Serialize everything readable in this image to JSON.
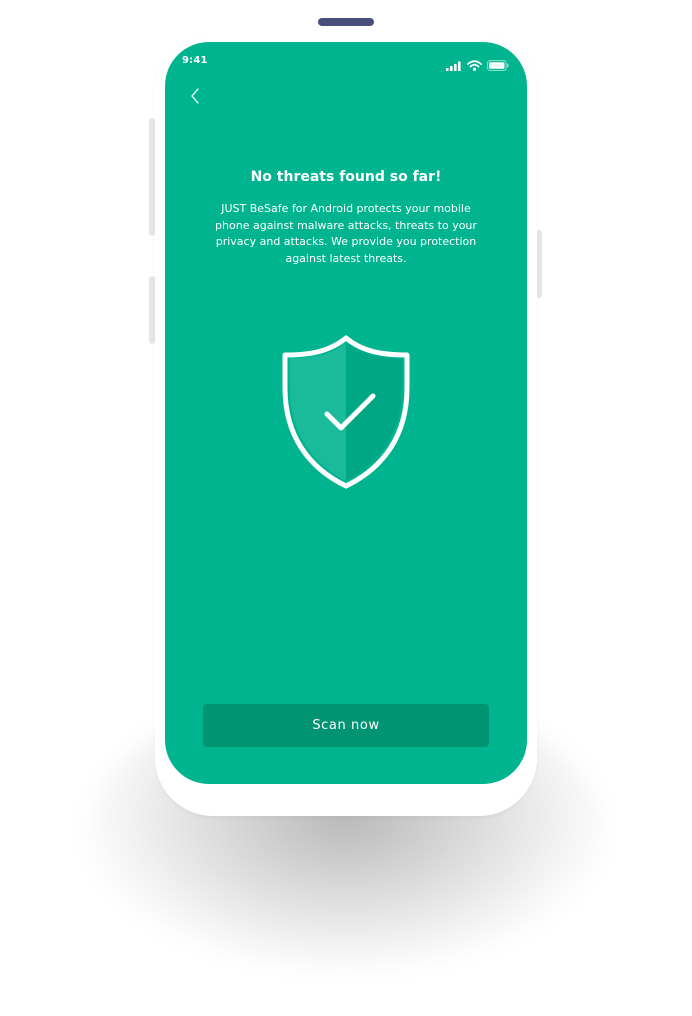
{
  "status_bar": {
    "time": "9:41",
    "icons": [
      "signal-icon",
      "wifi-icon",
      "battery-icon"
    ]
  },
  "nav": {
    "back_icon": "chevron-left-icon"
  },
  "main": {
    "title": "No threats found so far!",
    "description": "JUST BeSafe for Android protects your mobile phone against malware attacks, threats to your privacy and attacks. We provide you protection against latest threats.",
    "illustration": "shield-check-icon"
  },
  "actions": {
    "scan_label": "Scan now"
  },
  "colors": {
    "screen_background": "#00b48f",
    "button_background": "#009473",
    "text": "#ffffff",
    "top_indicator": "#4a4e7a"
  }
}
